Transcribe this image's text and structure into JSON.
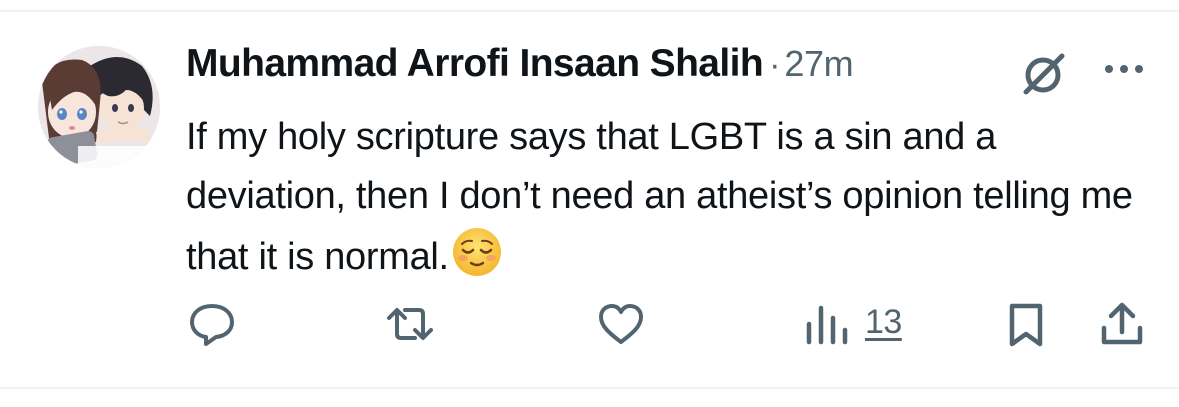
{
  "post": {
    "author_name": "Muhammad Arrofi Insaan Shalih",
    "separator": "·",
    "time_ago": "27m",
    "text": "If my holy scripture says that LGBT is a sin and a deviation, then I don’t need an atheist’s opinion telling me that it is normal.",
    "emoji": "relieved-face"
  },
  "actions": {
    "views_count": "13"
  },
  "icons": [
    "grok-icon",
    "more-icon",
    "reply-icon",
    "retweet-icon",
    "like-icon",
    "views-icon",
    "bookmark-icon",
    "share-icon"
  ],
  "colors": {
    "text_primary": "#0f1419",
    "text_secondary": "#536471",
    "divider": "#eff3f4"
  }
}
